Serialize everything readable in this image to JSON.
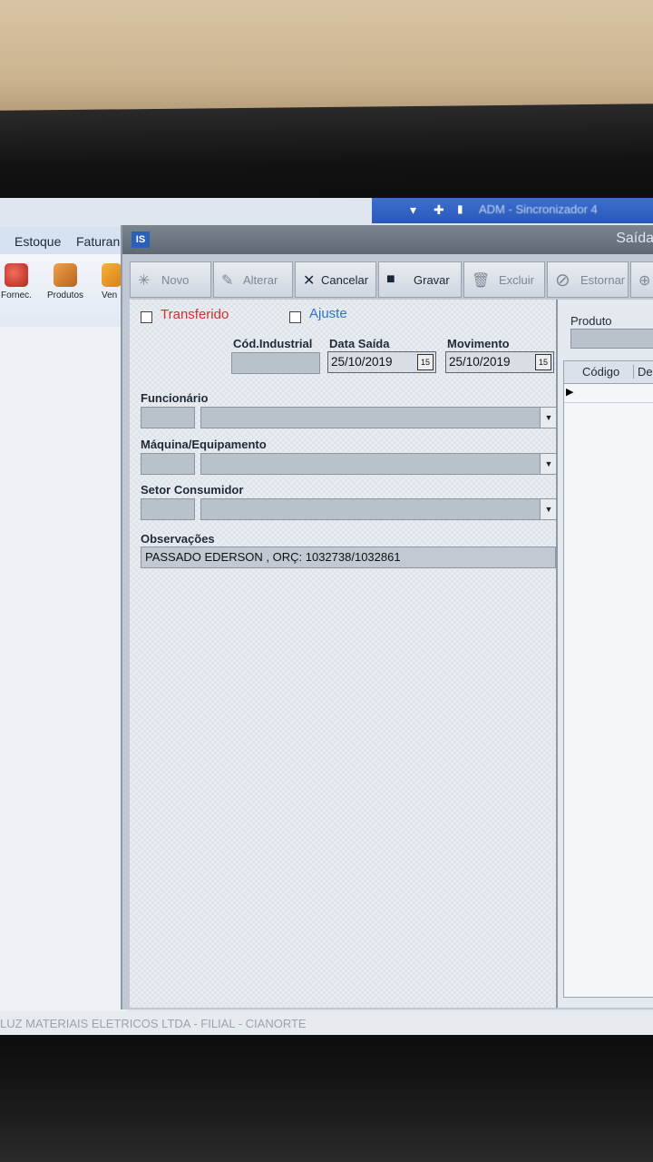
{
  "taskbar": {
    "title": "ADM - Sincronizador 4"
  },
  "main_menu": {
    "items": [
      "Estoque",
      "Faturan"
    ]
  },
  "main_toolbar": {
    "buttons": [
      {
        "label": "Fornec.",
        "icon": "supplier-icon"
      },
      {
        "label": "Produtos",
        "icon": "products-box-icon"
      },
      {
        "label": "Ven",
        "icon": "sales-icon"
      }
    ]
  },
  "window": {
    "app_icon": "IS",
    "title": "Saída",
    "toolbar": [
      {
        "label": "Novo",
        "icon": "new-icon"
      },
      {
        "label": "Alterar",
        "icon": "edit-icon"
      },
      {
        "label": "Cancelar",
        "icon": "cancel-icon"
      },
      {
        "label": "Gravar",
        "icon": "save-icon"
      },
      {
        "label": "Excluir",
        "icon": "trash-icon"
      },
      {
        "label": "Estornar",
        "icon": "reverse-icon"
      }
    ]
  },
  "form": {
    "transferido_label": "Transferido",
    "ajuste_label": "Ajuste",
    "cod_industrial_label": "Cód.Industrial",
    "cod_industrial_value": "",
    "data_saida_label": "Data Saída",
    "data_saida_value": "25/10/2019",
    "movimento_label": "Movimento",
    "movimento_value": "25/10/2019",
    "calendar_label": "15",
    "funcionario_label": "Funcionário",
    "maquina_label": "Máquina/Equipamento",
    "setor_label": "Setor Consumidor",
    "observacoes_label": "Observações",
    "observacoes_value": "PASSADO EDERSON , ORÇ: 1032738/1032861"
  },
  "side_panel": {
    "produto_label": "Produto",
    "grid_columns": [
      "Código",
      "De"
    ]
  },
  "statusbar": {
    "text": "LUZ MATERIAIS ELETRICOS LTDA  -  FILIAL - CIANORTE"
  },
  "colors": {
    "transferido": "#d0312d",
    "ajuste": "#2f73c9"
  }
}
